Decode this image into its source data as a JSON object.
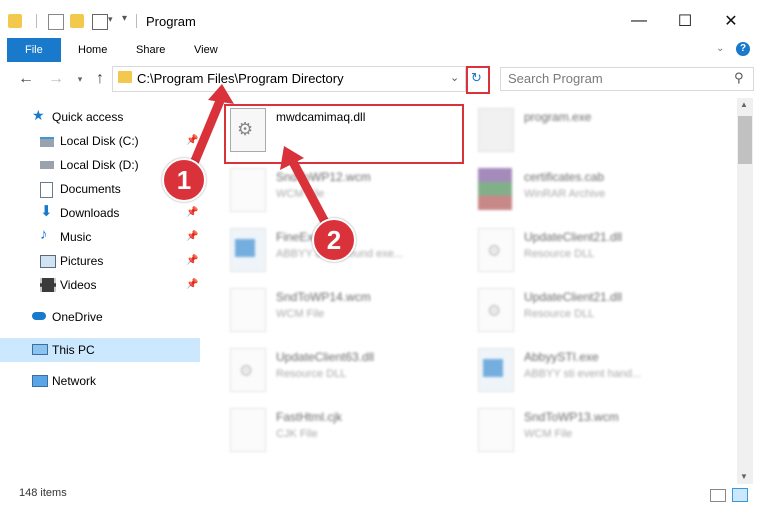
{
  "window": {
    "title": "Program",
    "controls": {
      "minimize": "—",
      "maximize": "☐",
      "close": "✕"
    }
  },
  "ribbon": {
    "tabs": [
      {
        "label": "File"
      },
      {
        "label": "Home"
      },
      {
        "label": "Share"
      },
      {
        "label": "View"
      }
    ],
    "help": "?"
  },
  "address": {
    "path": "C:\\Program Files\\Program Directory",
    "search_placeholder": "Search Program"
  },
  "nav": {
    "items": [
      {
        "label": "Quick access",
        "icon": "star-icon"
      },
      {
        "label": "Local Disk (C:)",
        "icon": "drive-icon",
        "pinned": true
      },
      {
        "label": "Local Disk (D:)",
        "icon": "drive-icon"
      },
      {
        "label": "Documents",
        "icon": "documents-icon",
        "pinned": true
      },
      {
        "label": "Downloads",
        "icon": "download-icon",
        "pinned": true
      },
      {
        "label": "Music",
        "icon": "music-icon",
        "pinned": true
      },
      {
        "label": "Pictures",
        "icon": "pictures-icon",
        "pinned": true
      },
      {
        "label": "Videos",
        "icon": "videos-icon",
        "pinned": true
      },
      {
        "label": "OneDrive",
        "icon": "cloud-icon"
      },
      {
        "label": "This PC",
        "icon": "computer-icon",
        "selected": true
      },
      {
        "label": "Network",
        "icon": "network-icon"
      }
    ]
  },
  "files": {
    "left": [
      {
        "name": "mwdcamimaq.dll",
        "type": ""
      },
      {
        "name": "SndToWP12.wcm",
        "type": "WCM File"
      },
      {
        "name": "FineExec.exe",
        "type": "ABBYY background exe..."
      },
      {
        "name": "SndToWP14.wcm",
        "type": "WCM File"
      },
      {
        "name": "UpdateClient63.dll",
        "type": "Resource DLL"
      },
      {
        "name": "FastHtml.cjk",
        "type": "CJK File"
      }
    ],
    "right": [
      {
        "name": "program.exe",
        "type": ""
      },
      {
        "name": "certificates.cab",
        "type": "WinRAR Archive"
      },
      {
        "name": "UpdateClient21.dll",
        "type": "Resource DLL"
      },
      {
        "name": "UpdateClient21.dll",
        "type": "Resource DLL"
      },
      {
        "name": "AbbyySTI.exe",
        "type": "ABBYY sti event hand..."
      },
      {
        "name": "SndToWP13.wcm",
        "type": "WCM File"
      }
    ]
  },
  "status": {
    "items_count": "148 items"
  },
  "callouts": {
    "one": "1",
    "two": "2"
  },
  "colors": {
    "accent": "#1979ca",
    "highlight": "#d9323b",
    "selected": "#cce8ff"
  }
}
